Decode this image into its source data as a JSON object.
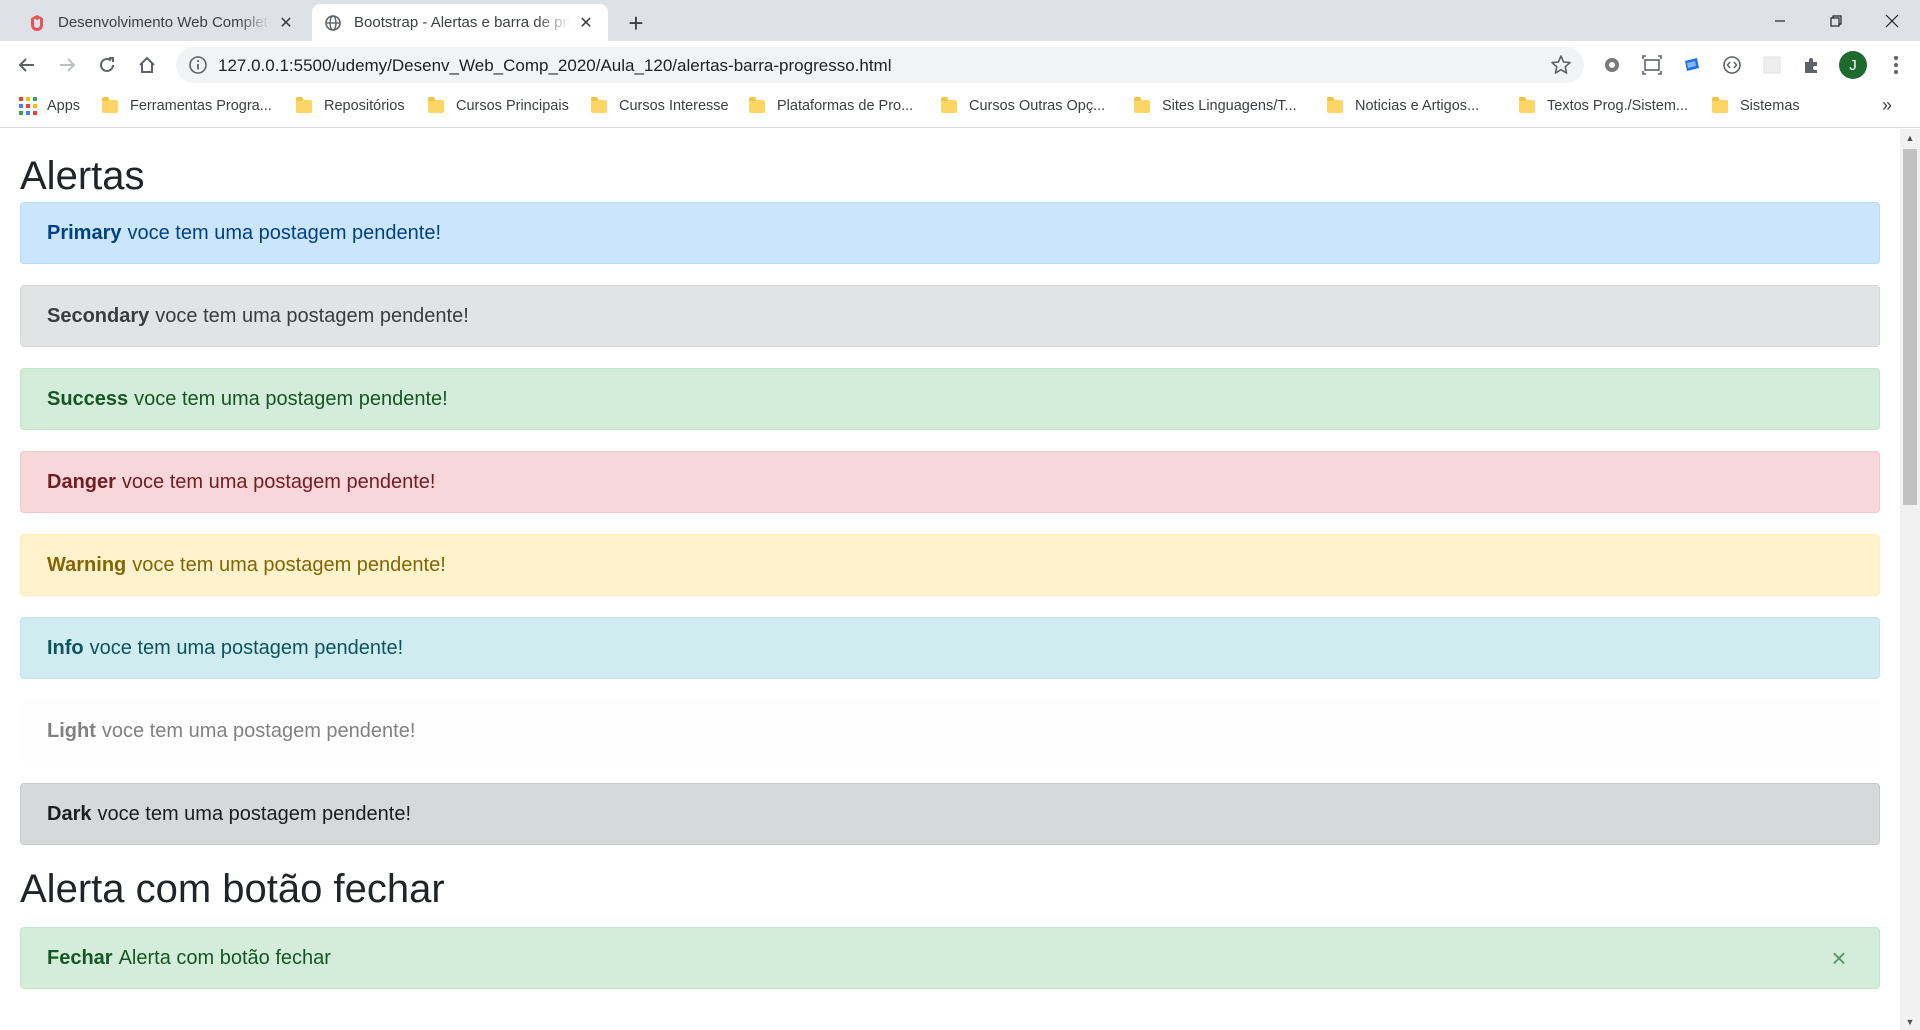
{
  "browser": {
    "tabs": [
      {
        "title": "Desenvolvimento Web Completo",
        "active": false,
        "favicon": "udemy-icon"
      },
      {
        "title": "Bootstrap - Alertas e barra de progresso",
        "active": true,
        "favicon": "globe-icon"
      }
    ],
    "url": "127.0.0.1:5500/udemy/Desenv_Web_Comp_2020/Aula_120/alertas-barra-progresso.html",
    "avatar_letter": "J",
    "bookmarks": [
      "Apps",
      "Ferramentas Progra...",
      "Repositórios",
      "Cursos Principais",
      "Cursos Interesse",
      "Plataformas de Pro...",
      "Cursos Outras Opç...",
      "Sites Linguagens/T...",
      "Noticias e Artigos...",
      "Textos Prog./Sistem...",
      "Sistemas"
    ],
    "bookmarks_overflow": "»"
  },
  "page": {
    "heading1": "Alertas",
    "alerts": [
      {
        "variant": "primary",
        "strong": "Primary",
        "text": "voce tem uma postagem pendente!"
      },
      {
        "variant": "secondary",
        "strong": "Secondary",
        "text": "voce tem uma postagem pendente!"
      },
      {
        "variant": "success",
        "strong": "Success",
        "text": "voce tem uma postagem pendente!"
      },
      {
        "variant": "danger",
        "strong": "Danger",
        "text": "voce tem uma postagem pendente!"
      },
      {
        "variant": "warning",
        "strong": "Warning",
        "text": "voce tem uma postagem pendente!"
      },
      {
        "variant": "info",
        "strong": "Info",
        "text": "voce tem uma postagem pendente!"
      },
      {
        "variant": "light",
        "strong": "Light",
        "text": "voce tem uma postagem pendente!"
      },
      {
        "variant": "dark",
        "strong": "Dark",
        "text": "voce tem uma postagem pendente!"
      }
    ],
    "heading2": "Alerta com botão fechar",
    "dismissible_alert": {
      "variant": "success",
      "strong": "Fechar",
      "text": "Alerta com botão fechar",
      "close_symbol": "×"
    }
  },
  "colors": {
    "primary_bg": "#cce5ff",
    "secondary_bg": "#e2e3e5",
    "success_bg": "#d4edda",
    "danger_bg": "#f8d7da",
    "warning_bg": "#fff3cd",
    "info_bg": "#d1ecf1",
    "light_bg": "#fefefe",
    "dark_bg": "#d6d8d9",
    "tabstrip": "#dee1e6"
  }
}
